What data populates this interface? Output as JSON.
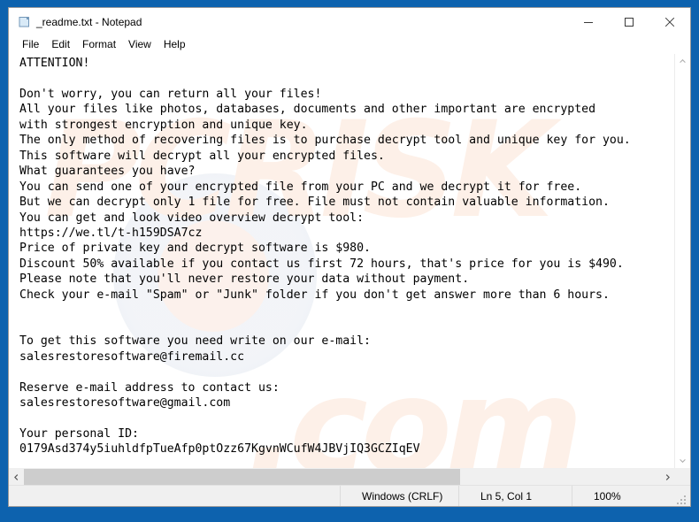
{
  "window": {
    "title": "_readme.txt - Notepad",
    "icon": "notepad-document-icon",
    "controls": {
      "minimize": "minimize-icon",
      "maximize": "maximize-icon",
      "close": "close-icon"
    }
  },
  "menu": {
    "items": [
      {
        "label": "File"
      },
      {
        "label": "Edit"
      },
      {
        "label": "Format"
      },
      {
        "label": "View"
      },
      {
        "label": "Help"
      }
    ]
  },
  "document": {
    "filename": "_readme.txt",
    "body": "ATTENTION!\n\nDon't worry, you can return all your files!\nAll your files like photos, databases, documents and other important are encrypted\nwith strongest encryption and unique key.\nThe only method of recovering files is to purchase decrypt tool and unique key for you.\nThis software will decrypt all your encrypted files.\nWhat guarantees you have?\nYou can send one of your encrypted file from your PC and we decrypt it for free.\nBut we can decrypt only 1 file for free. File must not contain valuable information.\nYou can get and look video overview decrypt tool:\nhttps://we.tl/t-h159DSA7cz\nPrice of private key and decrypt software is $980.\nDiscount 50% available if you contact us first 72 hours, that's price for you is $490.\nPlease note that you'll never restore your data without payment.\nCheck your e-mail \"Spam\" or \"Junk\" folder if you don't get answer more than 6 hours.\n\n\nTo get this software you need write on our e-mail:\nsalesrestoresoftware@firemail.cc\n\nReserve e-mail address to contact us:\nsalesrestoresoftware@gmail.com\n\nYour personal ID:\n0179Asd374y5iuhldfpTueAfp0ptOzz67KgvnWCufW4JBVjIQ3GCZIqEV",
    "lines": [
      "ATTENTION!",
      "",
      "Don't worry, you can return all your files!",
      "All your files like photos, databases, documents and other important are encrypted",
      "with strongest encryption and unique key.",
      "The only method of recovering files is to purchase decrypt tool and unique key for you.",
      "This software will decrypt all your encrypted files.",
      "What guarantees you have?",
      "You can send one of your encrypted file from your PC and we decrypt it for free.",
      "But we can decrypt only 1 file for free. File must not contain valuable information.",
      "You can get and look video overview decrypt tool:",
      "https://we.tl/t-h159DSA7cz",
      "Price of private key and decrypt software is $980.",
      "Discount 50% available if you contact us first 72 hours, that's price for you is $490.",
      "Please note that you'll never restore your data without payment.",
      "Check your e-mail \"Spam\" or \"Junk\" folder if you don't get answer more than 6 hours.",
      "",
      "",
      "To get this software you need write on our e-mail:",
      "salesrestoresoftware@firemail.cc",
      "",
      "Reserve e-mail address to contact us:",
      "salesrestoresoftware@gmail.com",
      "",
      "Your personal ID:",
      "0179Asd374y5iuhldfpTueAfp0ptOzz67KgvnWCufW4JBVjIQ3GCZIqEV"
    ],
    "video_url": "https://we.tl/t-h159DSA7cz",
    "price_full": "$980",
    "price_discount": "$490",
    "discount_percent": "50%",
    "discount_window_hours": "72",
    "response_time_hours": "6",
    "email_primary": "salesrestoresoftware@firemail.cc",
    "email_reserve": "salesrestoresoftware@gmail.com",
    "personal_id": "0179Asd374y5iuhldfpTueAfp0ptOzz67KgvnWCufW4JBVjIQ3GCZIqEV"
  },
  "statusbar": {
    "line_ending": "Windows (CRLF)",
    "cursor_position": "Ln 5, Col 1",
    "zoom": "100%"
  },
  "scrollbars": {
    "vertical": {
      "up": "scroll-up-arrow-icon",
      "down": "scroll-down-arrow-icon"
    },
    "horizontal": {
      "left": "scroll-left-arrow-icon",
      "right": "scroll-right-arrow-icon"
    }
  },
  "watermark": {
    "text_top": "PCRISK",
    "text_bottom": ".com"
  },
  "colors": {
    "desktop_background": "#0d62ae",
    "window_background": "#ffffff",
    "statusbar_background": "#f0f0f0",
    "scrollbar_thumb": "#cdcdcd",
    "watermark": "#fdf0e8"
  }
}
